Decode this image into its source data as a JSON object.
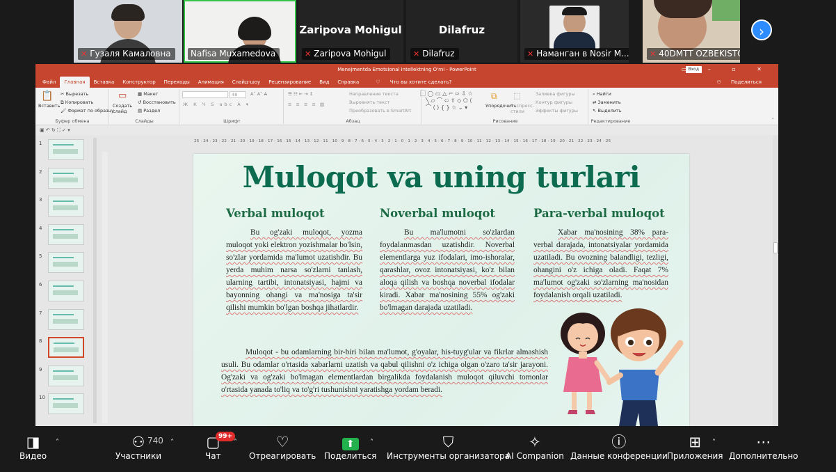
{
  "participants": [
    {
      "name": "Гузаля Камаловна",
      "video": true,
      "muted": true
    },
    {
      "name": "Nafisa Muxamedova",
      "video": true,
      "muted": false,
      "active": true
    },
    {
      "name": "Zaripova Mohigul",
      "video": false,
      "muted": true
    },
    {
      "name": "Dilafruz",
      "video": false,
      "muted": true
    },
    {
      "name": "Наманган в Nosir M...",
      "video": true,
      "muted": true
    },
    {
      "name": "40DMTT OZBEKISTO...",
      "video": true,
      "muted": true
    }
  ],
  "ppt": {
    "window_title": "Menejmentda Emotsional Intellektning O'rni  -  PowerPoint",
    "login_label": "Вход",
    "tabs": [
      "Файл",
      "Главная",
      "Вставка",
      "Конструктор",
      "Переходы",
      "Анимация",
      "Слайд-шоу",
      "Рецензирование",
      "Вид",
      "Справка"
    ],
    "tell_me": "Что вы хотите сделать?",
    "share": "Поделиться",
    "ribbon": {
      "clipboard": {
        "paste": "Вставить",
        "cut": "Вырезать",
        "copy": "Копировать",
        "format": "Формат по образцу",
        "label": "Буфер обмена"
      },
      "slides": {
        "new": "Создать слайд",
        "layout": "Макет",
        "reset": "Восстановить",
        "section": "Раздел",
        "label": "Слайды"
      },
      "font": {
        "label": "Шрифт",
        "size": "48"
      },
      "paragraph": {
        "dir": "Направление текста",
        "align": "Выровнять текст",
        "smartart": "Преобразовать в SmartArt",
        "label": "Абзац"
      },
      "drawing": {
        "arrange": "Упорядочить",
        "styles": "Экспресс-стили",
        "fill": "Заливка фигуры",
        "outline": "Контур фигуры",
        "effects": "Эффекты фигуры",
        "label": "Рисование"
      },
      "editing": {
        "find": "Найти",
        "replace": "Заменить",
        "select": "Выделить",
        "label": "Редактирование"
      }
    },
    "slide_numbers": [
      "1",
      "2",
      "3",
      "4",
      "5",
      "6",
      "7",
      "8",
      "9",
      "10"
    ],
    "ruler": "25 · 24 · 23 · 22 · 21 · 20 · 19 · 18 · 17 · 16 · 15 · 14 · 13 · 12 · 11 · 10 · 9 · 8 · 7 · 6 · 5 · 4 · 3 · 2 · 1 · 0 · 1 · 2 · 3 · 4 · 5 · 6 · 7 · 8 · 9 · 10 · 11 · 12 · 13 · 14 · 15 · 16 · 17 · 18 · 19 · 20 · 21 · 22 · 23 · 24 · 25"
  },
  "slide": {
    "title": "Muloqot va uning turlari",
    "columns": [
      {
        "heading": "Verbal muloqot",
        "text": "Bu og'zaki muloqot, yozma muloqot yoki elektron yozishmalar bo'lsin, so'zlar yordamida ma'lumot uzatishdir. Bu yerda muhim narsa so'zlarni tanlash, ularning tartibi, intonatsiyasi, hajmi va bayonning ohangi va ma'nosiga ta'sir qilishi mumkin bo'lgan boshqa jihatlardir."
      },
      {
        "heading": "Noverbal muloqot",
        "text": "Bu ma'lumotni so'zlardan foydalanmasdan uzatishdir. Noverbal elementlarga yuz ifodalari, imo-ishoralar, qarashlar, ovoz intonatsiyasi, ko'z bilan aloqa qilish va boshqa noverbal ifodalar kiradi. Xabar ma'nosining 55% og'zaki bo'lmagan darajada uzatiladi."
      },
      {
        "heading": "Para-verbal muloqot",
        "text": "Xabar ma'nosining 38% para-verbal darajada, intonatsiyalar yordamida uzatiladi. Bu ovozning balandligi, tezligi, ohangini o'z ichiga oladi. Faqat 7% ma'lumot og'zaki so'zlarning ma'nosidan foydalanish orqali uzatiladi."
      }
    ],
    "paragraph": "Muloqot - bu odamlarning bir-biri bilan ma'lumot, g'oyalar, his-tuyg'ular va fikrlar almashish usuli. Bu odamlar o'rtasida xabarlarni uzatish va qabul qilishni o'z ichiga olgan o'zaro ta'sir jarayoni. Og'zaki va og'zaki bo'lmagan elementlardan birgalikda foydalanish muloqot qiluvchi tomonlar o'rtasida yanada to'liq va to'g'ri tushunishni yaratishga yordam beradi."
  },
  "toolbar": {
    "video": "Видео",
    "participants": "Участники",
    "participants_count": "740",
    "chat": "Чат",
    "chat_badge": "99+",
    "react": "Отреагировать",
    "share": "Поделиться",
    "host_tools": "Инструменты организатора",
    "ai": "AI Companion",
    "info": "Данные конференции",
    "apps": "Приложения",
    "more": "Дополнительно"
  },
  "colors": {
    "ppt_accent": "#c5452f",
    "slide_title": "#0d6b4f",
    "heading": "#1d6b44",
    "share_green": "#23b14d",
    "badge_red": "#e22d2d"
  }
}
